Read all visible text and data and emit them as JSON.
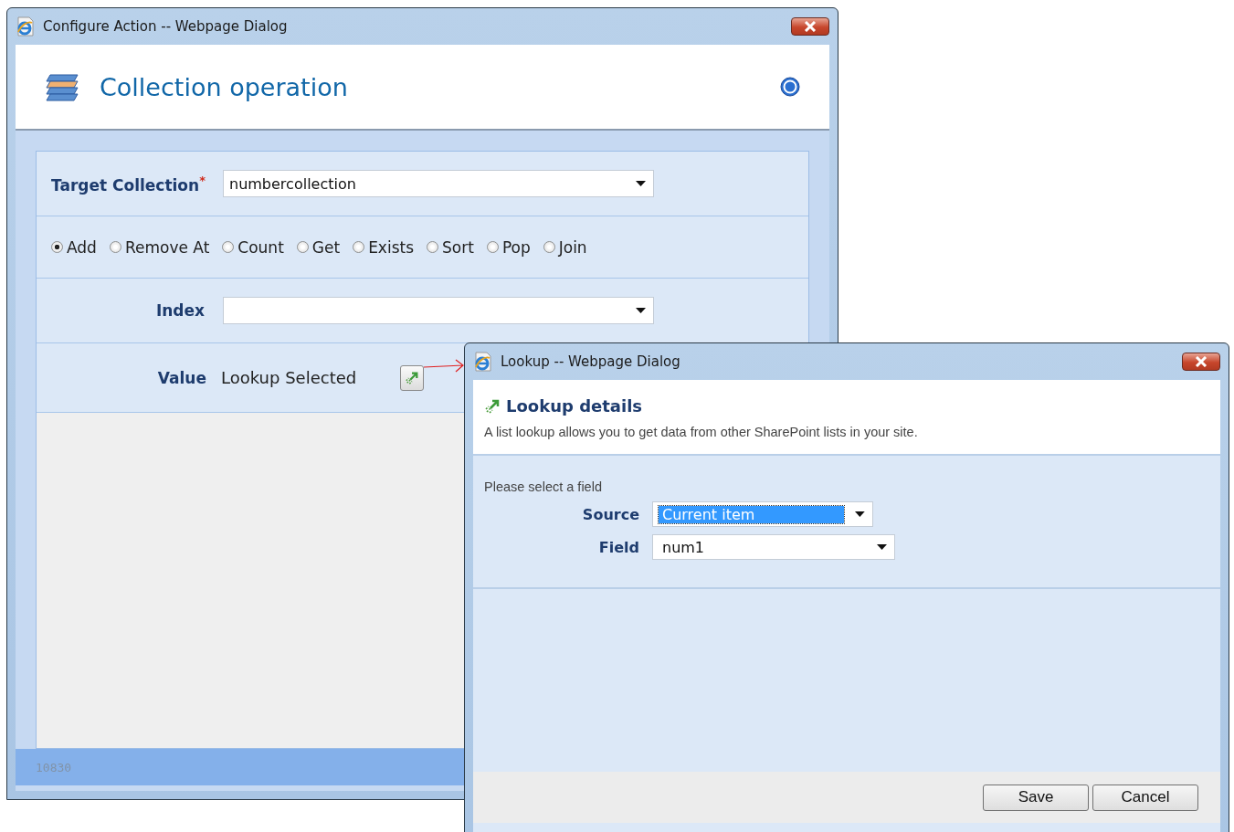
{
  "configure_dialog": {
    "title": "Configure Action -- Webpage Dialog",
    "heading": "Collection operation",
    "target": {
      "label": "Target Collection",
      "required_mark": "*",
      "value": "numbercollection",
      "highlighted": false
    },
    "operations": [
      {
        "label": "Add",
        "selected": true
      },
      {
        "label": "Remove At",
        "selected": false
      },
      {
        "label": "Count",
        "selected": false
      },
      {
        "label": "Get",
        "selected": false
      },
      {
        "label": "Exists",
        "selected": false
      },
      {
        "label": "Sort",
        "selected": false
      },
      {
        "label": "Pop",
        "selected": false
      },
      {
        "label": "Join",
        "selected": false
      }
    ],
    "index": {
      "label": "Index",
      "highlighted": false
    },
    "value": {
      "label": "Value",
      "text": "Lookup Selected"
    },
    "footer_code": "10830"
  },
  "lookup_dialog": {
    "title": "Lookup -- Webpage Dialog",
    "heading": "Lookup details",
    "description": "A list lookup allows you to get data from other SharePoint lists in your site.",
    "prompt": "Please select a field",
    "fields": [
      {
        "label": "Source",
        "value": "Current item",
        "highlighted": true
      },
      {
        "label": "Field",
        "value": "num1",
        "highlighted": false
      }
    ],
    "buttons": [
      "Save",
      "Cancel"
    ]
  }
}
